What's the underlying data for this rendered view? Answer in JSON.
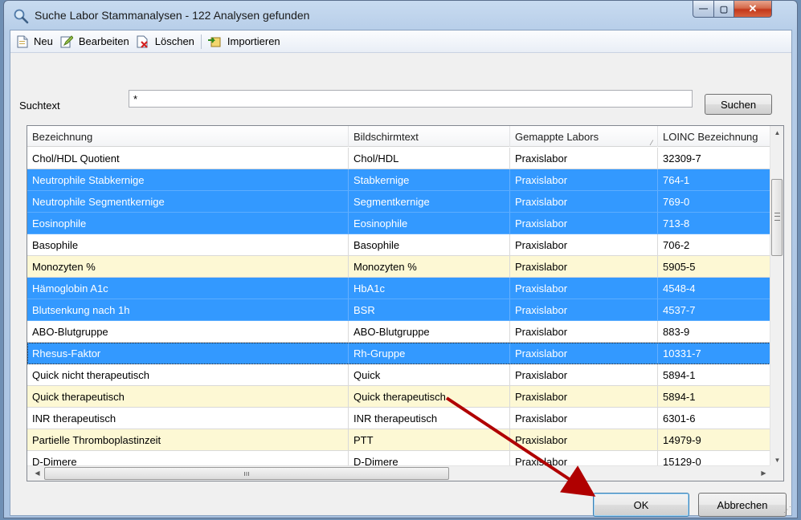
{
  "window": {
    "title": "Suche Labor Stammanalysen - 122 Analysen gefunden",
    "minimize_symbol": "—",
    "maximize_symbol": "▢",
    "close_symbol": "✕",
    "icon": "magnifier-icon"
  },
  "toolbar": {
    "items": [
      {
        "label": "Neu",
        "icon": "new-document-icon"
      },
      {
        "label": "Bearbeiten",
        "icon": "edit-icon"
      },
      {
        "label": "Löschen",
        "icon": "delete-icon"
      },
      {
        "label": "Importieren",
        "icon": "import-icon"
      }
    ]
  },
  "search": {
    "label": "Suchtext",
    "value": "*",
    "button_label": "Suchen"
  },
  "grid": {
    "columns": [
      "Bezeichnung",
      "Bildschirmtext",
      "Gemappte Labors",
      "LOINC Bezeichnung"
    ],
    "rows": [
      {
        "name": "Chol/HDL Quotient",
        "screen": "Chol/HDL",
        "labs": "Praxislabor",
        "loinc": "32309-7",
        "state": "normal"
      },
      {
        "name": "Neutrophile Stabkernige",
        "screen": "Stabkernige",
        "labs": "Praxislabor",
        "loinc": "764-1",
        "state": "selected"
      },
      {
        "name": "Neutrophile Segmentkernige",
        "screen": "Segmentkernige",
        "labs": "Praxislabor",
        "loinc": "769-0",
        "state": "selected"
      },
      {
        "name": "Eosinophile",
        "screen": "Eosinophile",
        "labs": "Praxislabor",
        "loinc": "713-8",
        "state": "selected"
      },
      {
        "name": "Basophile",
        "screen": "Basophile",
        "labs": "Praxislabor",
        "loinc": "706-2",
        "state": "normal"
      },
      {
        "name": "Monozyten %",
        "screen": "Monozyten %",
        "labs": "Praxislabor",
        "loinc": "5905-5",
        "state": "alt"
      },
      {
        "name": "Hämoglobin A1c",
        "screen": "HbA1c",
        "labs": "Praxislabor",
        "loinc": "4548-4",
        "state": "selected"
      },
      {
        "name": "Blutsenkung nach 1h",
        "screen": "BSR",
        "labs": "Praxislabor",
        "loinc": "4537-7",
        "state": "selected"
      },
      {
        "name": "ABO-Blutgruppe",
        "screen": "ABO-Blutgruppe",
        "labs": "Praxislabor",
        "loinc": "883-9",
        "state": "normal"
      },
      {
        "name": "Rhesus-Faktor",
        "screen": "Rh-Gruppe",
        "labs": "Praxislabor",
        "loinc": "10331-7",
        "state": "selected"
      },
      {
        "name": "Quick nicht therapeutisch",
        "screen": "Quick",
        "labs": "Praxislabor",
        "loinc": "5894-1",
        "state": "normal"
      },
      {
        "name": "Quick therapeutisch",
        "screen": "Quick therapeutisch",
        "labs": "Praxislabor",
        "loinc": "5894-1",
        "state": "alt"
      },
      {
        "name": "INR therapeutisch",
        "screen": "INR therapeutisch",
        "labs": "Praxislabor",
        "loinc": "6301-6",
        "state": "normal"
      },
      {
        "name": "Partielle Thromboplastinzeit",
        "screen": "PTT",
        "labs": "Praxislabor",
        "loinc": "14979-9",
        "state": "alt"
      },
      {
        "name": "D-Dimere",
        "screen": "D-Dimere",
        "labs": "Praxislabor",
        "loinc": "15129-0",
        "state": "normal"
      }
    ]
  },
  "buttons": {
    "ok": "OK",
    "cancel": "Abbrechen"
  },
  "colors": {
    "selection": "#3399ff",
    "alt_row": "#fdf8d4",
    "annotation_arrow": "#b00000"
  }
}
